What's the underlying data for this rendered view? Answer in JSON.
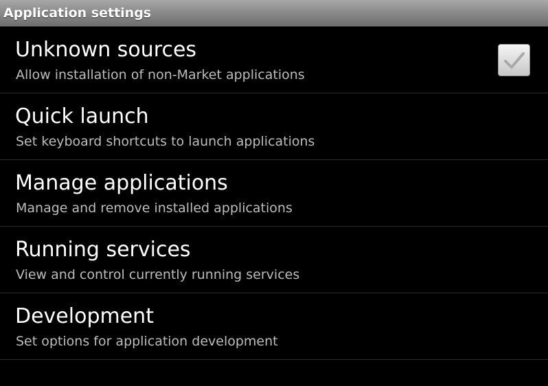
{
  "header": {
    "title": "Application settings"
  },
  "items": [
    {
      "title": "Unknown sources",
      "summary": "Allow installation of non-Market applications",
      "has_checkbox": true,
      "checked": true
    },
    {
      "title": "Quick launch",
      "summary": "Set keyboard shortcuts to launch applications"
    },
    {
      "title": "Manage applications",
      "summary": "Manage and remove installed applications"
    },
    {
      "title": "Running services",
      "summary": "View and control currently running services"
    },
    {
      "title": "Development",
      "summary": "Set options for application development"
    }
  ],
  "colors": {
    "background": "#000000",
    "title_bar": "#8c8c8c",
    "summary_text": "#bdbdbd",
    "divider": "#2e2e2e"
  }
}
